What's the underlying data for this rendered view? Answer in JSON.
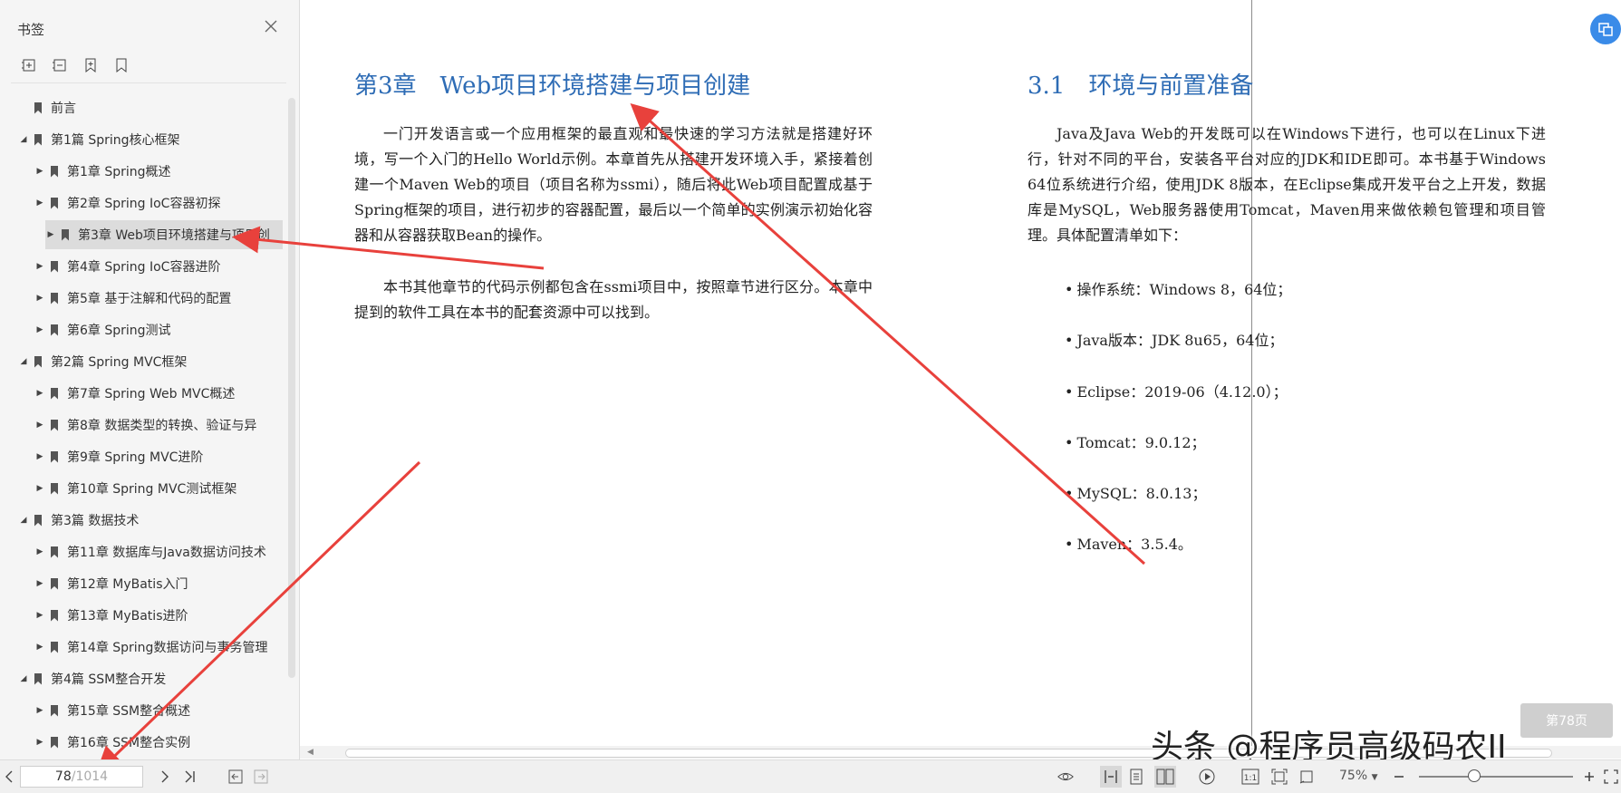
{
  "sidebar": {
    "title": "书签",
    "outline": [
      {
        "label": "前言",
        "level": 0,
        "arrow": "",
        "selected": false
      },
      {
        "label": "第1篇 Spring核心框架",
        "level": 0,
        "arrow": "expanded",
        "selected": false
      },
      {
        "label": "第1章 Spring概述",
        "level": 1,
        "arrow": "collapsed",
        "selected": false
      },
      {
        "label": "第2章 Spring IoC容器初探",
        "level": 1,
        "arrow": "collapsed",
        "selected": false
      },
      {
        "label": "第3章 Web项目环境搭建与项目创",
        "level": 1,
        "arrow": "collapsed",
        "selected": true
      },
      {
        "label": "第4章 Spring IoC容器进阶",
        "level": 1,
        "arrow": "collapsed",
        "selected": false
      },
      {
        "label": "第5章 基于注解和代码的配置",
        "level": 1,
        "arrow": "collapsed",
        "selected": false
      },
      {
        "label": "第6章 Spring测试",
        "level": 1,
        "arrow": "collapsed",
        "selected": false
      },
      {
        "label": "第2篇 Spring MVC框架",
        "level": 0,
        "arrow": "expanded",
        "selected": false
      },
      {
        "label": "第7章 Spring Web MVC概述",
        "level": 1,
        "arrow": "collapsed",
        "selected": false
      },
      {
        "label": "第8章 数据类型的转换、验证与异",
        "level": 1,
        "arrow": "collapsed",
        "selected": false
      },
      {
        "label": "第9章 Spring MVC进阶",
        "level": 1,
        "arrow": "collapsed",
        "selected": false
      },
      {
        "label": "第10章 Spring MVC测试框架",
        "level": 1,
        "arrow": "collapsed",
        "selected": false
      },
      {
        "label": "第3篇 数据技术",
        "level": 0,
        "arrow": "expanded",
        "selected": false
      },
      {
        "label": "第11章 数据库与Java数据访问技术",
        "level": 1,
        "arrow": "collapsed",
        "selected": false
      },
      {
        "label": "第12章 MyBatis入门",
        "level": 1,
        "arrow": "collapsed",
        "selected": false
      },
      {
        "label": "第13章 MyBatis进阶",
        "level": 1,
        "arrow": "collapsed",
        "selected": false
      },
      {
        "label": "第14章 Spring数据访问与事务管理",
        "level": 1,
        "arrow": "collapsed",
        "selected": false
      },
      {
        "label": "第4篇 SSM整合开发",
        "level": 0,
        "arrow": "expanded",
        "selected": false
      },
      {
        "label": "第15章 SSM整合概述",
        "level": 1,
        "arrow": "collapsed",
        "selected": false
      },
      {
        "label": "第16章 SSM整合实例",
        "level": 1,
        "arrow": "collapsed",
        "selected": false
      }
    ]
  },
  "left_page": {
    "heading": "第3章　Web项目环境搭建与项目创建",
    "para1": "一门开发语言或一个应用框架的最直观和最快速的学习方法就是搭建好环境，写一个入门的Hello World示例。本章首先从搭建开发环境入手，紧接着创建一个Maven Web的项目（项目名称为ssmi），随后将此Web项目配置成基于Spring框架的项目，进行初步的容器配置，最后以一个简单的实例演示初始化容器和从容器获取Bean的操作。",
    "para2": "本书其他章节的代码示例都包含在ssmi项目中，按照章节进行区分。本章中提到的软件工具在本书的配套资源中可以找到。"
  },
  "right_page": {
    "heading": "3.1　环境与前置准备",
    "para": "Java及Java Web的开发既可以在Windows下进行，也可以在Linux下进行，针对不同的平台，安装各平台对应的JDK和IDE即可。本书基于Windows 64位系统进行介绍，使用JDK 8版本，在Eclipse集成开发平台之上开发，数据库是MySQL，Web服务器使用Tomcat，Maven用来做依赖包管理和项目管理。具体配置清单如下：",
    "bullets": [
      "操作系统：Windows 8，64位；",
      "Java版本：JDK 8u65，64位；",
      "Eclipse：2019-06（4.12.0）；",
      "Tomcat：9.0.12；",
      "MySQL：8.0.13；",
      "Maven：3.5.4。"
    ]
  },
  "page_badge": "第78页",
  "watermark": "头条 @程序员高级码农II",
  "statusbar": {
    "page_current": "78",
    "page_total": "/1014",
    "zoom": "75%"
  },
  "colors": {
    "heading_blue": "#2e6cb5",
    "annotation_red": "#e8413c",
    "accent_blue": "#3a8be8"
  }
}
